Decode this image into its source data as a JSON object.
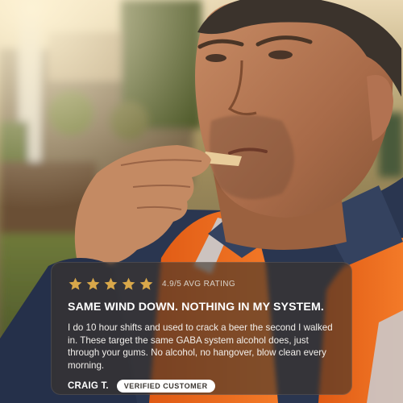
{
  "review": {
    "stars": 5,
    "star_color": "#d9a84a",
    "rating_label": "4.9/5 AVG RATING",
    "headline": "SAME WIND DOWN. NOTHING IN MY SYSTEM.",
    "body": "I do 10 hour shifts and used to crack a beer the second I walked in. These target the same GABA system alcohol does, just through your gums. No alcohol, no hangover, blow clean every morning.",
    "author": "CRAIG T.",
    "badge": "VERIFIED CUSTOMER"
  },
  "colors": {
    "hi_vis_orange": "#f06a1e",
    "shirt_navy": "#2a3650",
    "reflective_stripe": "#c9cdd2"
  }
}
